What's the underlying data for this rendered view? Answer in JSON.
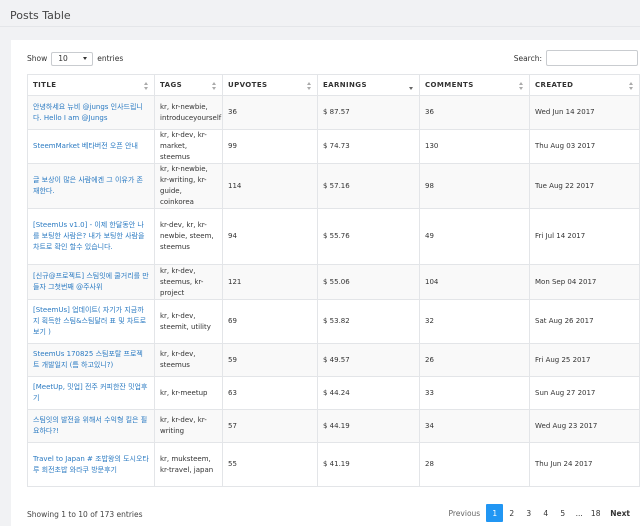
{
  "page": {
    "title": "Posts Table"
  },
  "length": {
    "show_label": "Show",
    "value": "10",
    "entries_label": "entries"
  },
  "search": {
    "label": "Search:"
  },
  "table": {
    "headers": [
      "TITLE",
      "TAGS",
      "UPVOTES",
      "EARNINGS",
      "COMMENTS",
      "CREATED"
    ],
    "rows": [
      {
        "title": "안녕하세요 뉴비 @jungs 인사드립니다. Hello I am @Jungs",
        "tags": "kr, kr-newbie, introduceyourself",
        "upvotes": "36",
        "earnings": "$ 87.57",
        "comments": "36",
        "created": "Wed Jun 14 2017"
      },
      {
        "title": "SteemMarket 베타버전 오픈 안내",
        "tags": "kr, kr-dev, kr-market, steemus",
        "upvotes": "99",
        "earnings": "$ 74.73",
        "comments": "130",
        "created": "Thu Aug 03 2017"
      },
      {
        "title": "글 보상이 많은 사람에겐 그 이유가 존재한다.",
        "tags": "kr, kr-newbie, kr-writing, kr-guide, coinkorea",
        "upvotes": "114",
        "earnings": "$ 57.16",
        "comments": "98",
        "created": "Tue Aug 22 2017"
      },
      {
        "title": "[SteemUs v1.0] - 이제 한달동안 나를 보팅한 사람은? 내가 보팅한 사람을 차트로 확인 할수 있습니다.",
        "tags": "kr-dev, kr, kr-newbie, steem, steemus",
        "upvotes": "94",
        "earnings": "$ 55.76",
        "comments": "49",
        "created": "Fri Jul 14 2017"
      },
      {
        "title": "[신규@프로젝트] 스팀잇에 쿨거리를 만들자 그첫번째 @주사위",
        "tags": "kr, kr-dev, steemus, kr-project",
        "upvotes": "121",
        "earnings": "$ 55.06",
        "comments": "104",
        "created": "Mon Sep 04 2017"
      },
      {
        "title": "[SteemUs] 업데이트( 자기가 지금까지 획득한 스팀&스팀달러 표 및 차트로 보기 )",
        "tags": "kr, kr-dev, steemit, utility",
        "upvotes": "69",
        "earnings": "$ 53.82",
        "comments": "32",
        "created": "Sat Aug 26 2017"
      },
      {
        "title": "SteemUs 170825 스팀포탈 프로젝트 개발일지 (틈 하고있니?)",
        "tags": "kr, kr-dev, steemus",
        "upvotes": "59",
        "earnings": "$ 49.57",
        "comments": "26",
        "created": "Fri Aug 25 2017"
      },
      {
        "title": "[MeetUp, 밋업] 전주 커피한잔 밋업후기",
        "tags": "kr, kr-meetup",
        "upvotes": "63",
        "earnings": "$ 44.24",
        "comments": "33",
        "created": "Sun Aug 27 2017"
      },
      {
        "title": "스팀잇의 발전을 위해서 수익형 킬은 필요하다?!",
        "tags": "kr, kr-dev, kr-writing",
        "upvotes": "57",
        "earnings": "$ 44.19",
        "comments": "34",
        "created": "Wed Aug 23 2017"
      },
      {
        "title": "Travel to Japan # 조밥왕의 도시오타루 회전초밥 와라쿠 방문후기",
        "tags": "kr, muksteem, kr-travel, japan",
        "upvotes": "55",
        "earnings": "$ 41.19",
        "comments": "28",
        "created": "Thu Jun 24 2017"
      }
    ]
  },
  "info": "Showing 1 to 10 of 173 entries",
  "pagination": {
    "previous": "Previous",
    "pages": [
      "1",
      "2",
      "3",
      "4",
      "5"
    ],
    "ellipsis": "...",
    "last": "18",
    "next": "Next",
    "current": "1"
  },
  "colors": {
    "link": "#2a7ac2",
    "active_page": "#2196f3",
    "background": "#f1f2f4"
  }
}
